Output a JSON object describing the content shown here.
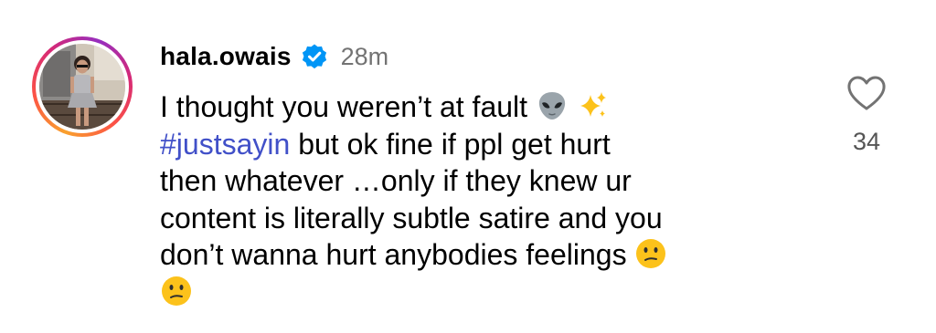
{
  "comment": {
    "username": "hala.owais",
    "verified": true,
    "timestamp": "28m",
    "lines": [
      "I thought you weren’t at fault",
      "but ok fine if ppl get hurt",
      "then whatever …only if they knew ur",
      "content is literally subtle satire and you",
      "don’t wanna hurt anybodies feelings"
    ],
    "hashtag": "#justsayin",
    "emojis": [
      "alien-icon",
      "sparkles-icon",
      "confused-face-icon",
      "confused-face-icon"
    ],
    "like_count": "34"
  },
  "colors": {
    "text": "#000000",
    "secondary_text": "#737373",
    "hashtag": "#4150c8",
    "verified_badge": "#0095f6",
    "like_count": "#555555"
  }
}
